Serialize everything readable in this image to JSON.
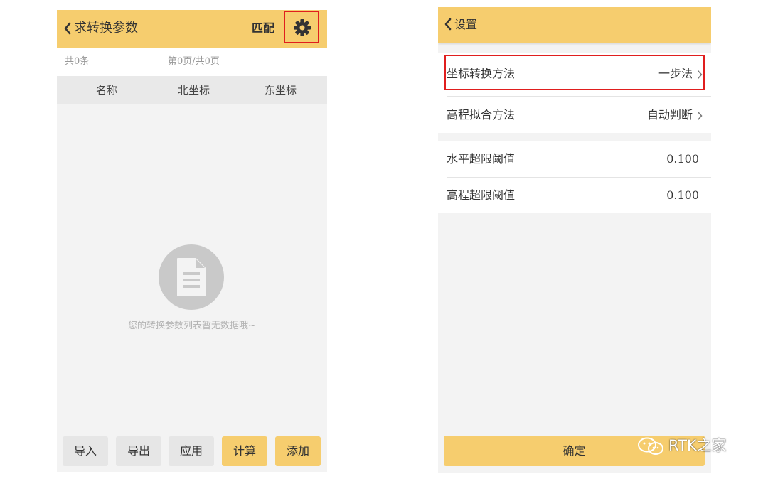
{
  "left_screen": {
    "header": {
      "title": "求转换参数",
      "match_label": "匹配",
      "settings_icon": "gear-icon"
    },
    "pager": {
      "count": "共0条",
      "page": "第0页/共0页"
    },
    "table": {
      "columns": [
        "名称",
        "北坐标",
        "东坐标"
      ],
      "rows": []
    },
    "empty_state": {
      "icon": "document-icon",
      "message": "您的转换参数列表暂无数据哦~"
    },
    "buttons": [
      {
        "label": "导入",
        "style": "gray"
      },
      {
        "label": "导出",
        "style": "gray"
      },
      {
        "label": "应用",
        "style": "gray"
      },
      {
        "label": "计算",
        "style": "yellow"
      },
      {
        "label": "添加",
        "style": "yellow"
      }
    ]
  },
  "right_screen": {
    "header": {
      "title": "设置"
    },
    "settings": [
      {
        "label": "坐标转换方法",
        "value": "一步法",
        "chevron": true
      },
      {
        "label": "高程拟合方法",
        "value": "自动判断",
        "chevron": true
      },
      {
        "label": "水平超限阈值",
        "value": "0.100",
        "chevron": false
      },
      {
        "label": "高程超限阈值",
        "value": "0.100",
        "chevron": false
      }
    ],
    "confirm_label": "确定"
  },
  "watermark": {
    "text": "RTK之家",
    "icon": "wechat-icon"
  },
  "colors": {
    "accent": "#f6cd6e",
    "background": "#f3f3f3",
    "highlight_border": "#e01e1e",
    "button_gray": "#e6e6e6"
  }
}
